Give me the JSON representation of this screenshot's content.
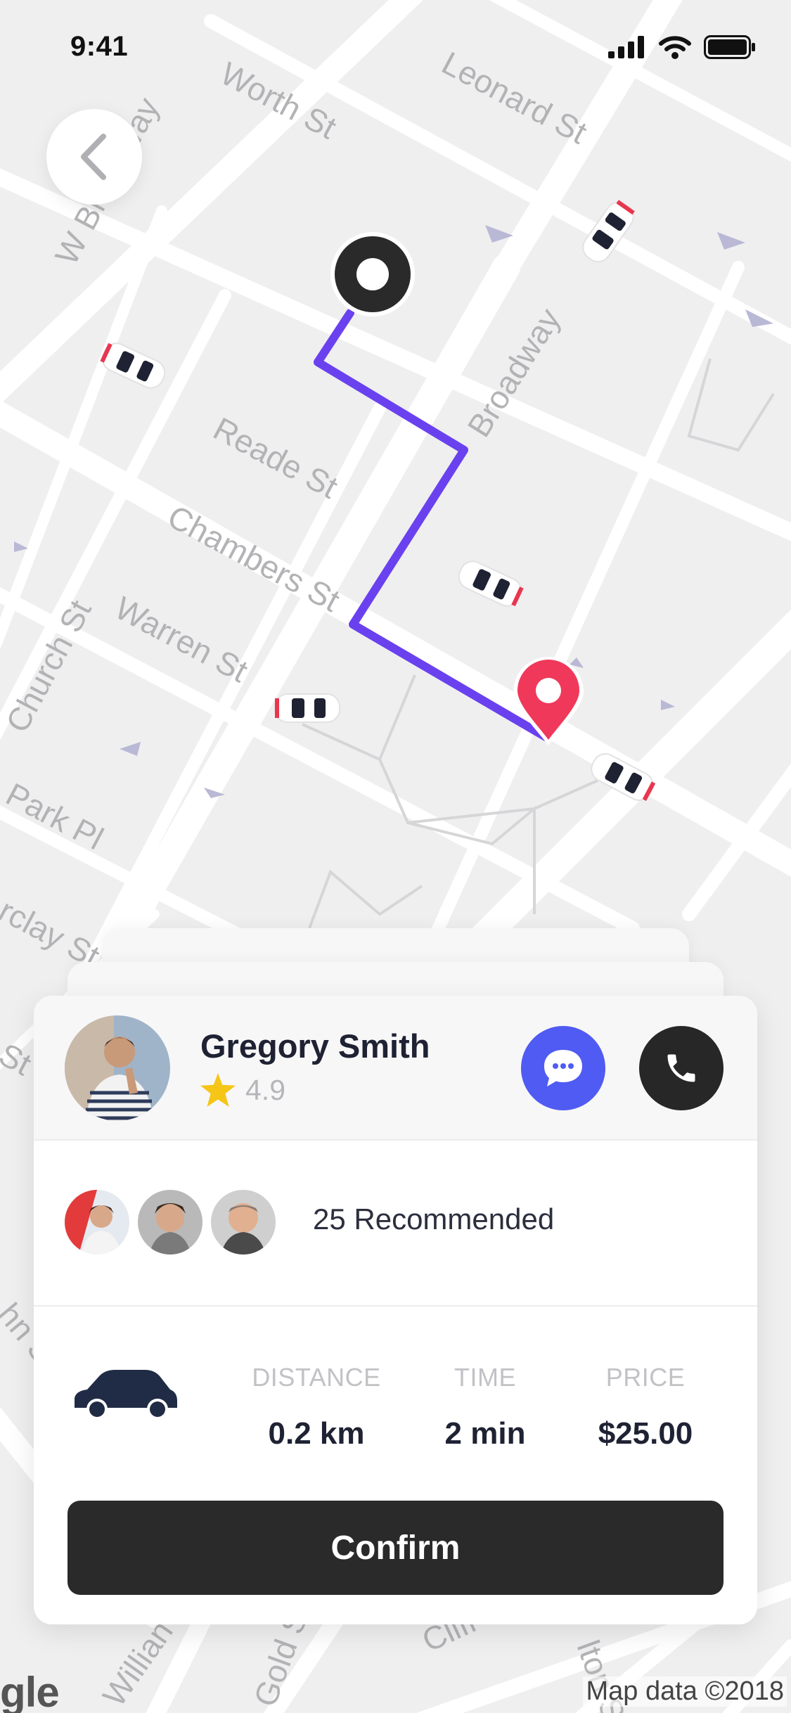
{
  "status_bar": {
    "time": "9:41"
  },
  "map": {
    "streets": [
      "Worth St",
      "Leonard St",
      "W Broadway",
      "Broadway",
      "Reade St",
      "Chambers St",
      "Warren St",
      "Church St",
      "Park Pl",
      "rclay St",
      "St",
      "hn S",
      "Willian",
      "Gold St",
      "Cliff St",
      "lton S"
    ],
    "attribution": "Map data ©2018",
    "logo_text": "gle"
  },
  "driver": {
    "name": "Gregory Smith",
    "rating": "4.9"
  },
  "recommendations": {
    "label": "25 Recommended"
  },
  "trip": {
    "distance_label": "DISTANCE",
    "distance_value": "0.2 km",
    "time_label": "TIME",
    "time_value": "2 min",
    "price_label": "PRICE",
    "price_value": "$25.00"
  },
  "actions": {
    "confirm_label": "Confirm"
  },
  "colors": {
    "route": "#6a41ef",
    "destination_pin": "#f0385a",
    "message_button": "#4f5bf2",
    "call_button": "#272727",
    "rating_star": "#f5c518"
  },
  "icons": [
    "back-chevron-icon",
    "origin-marker-icon",
    "destination-pin-icon",
    "car-icon",
    "star-icon",
    "chat-bubble-icon",
    "phone-icon",
    "signal-icon",
    "wifi-icon",
    "battery-icon"
  ]
}
